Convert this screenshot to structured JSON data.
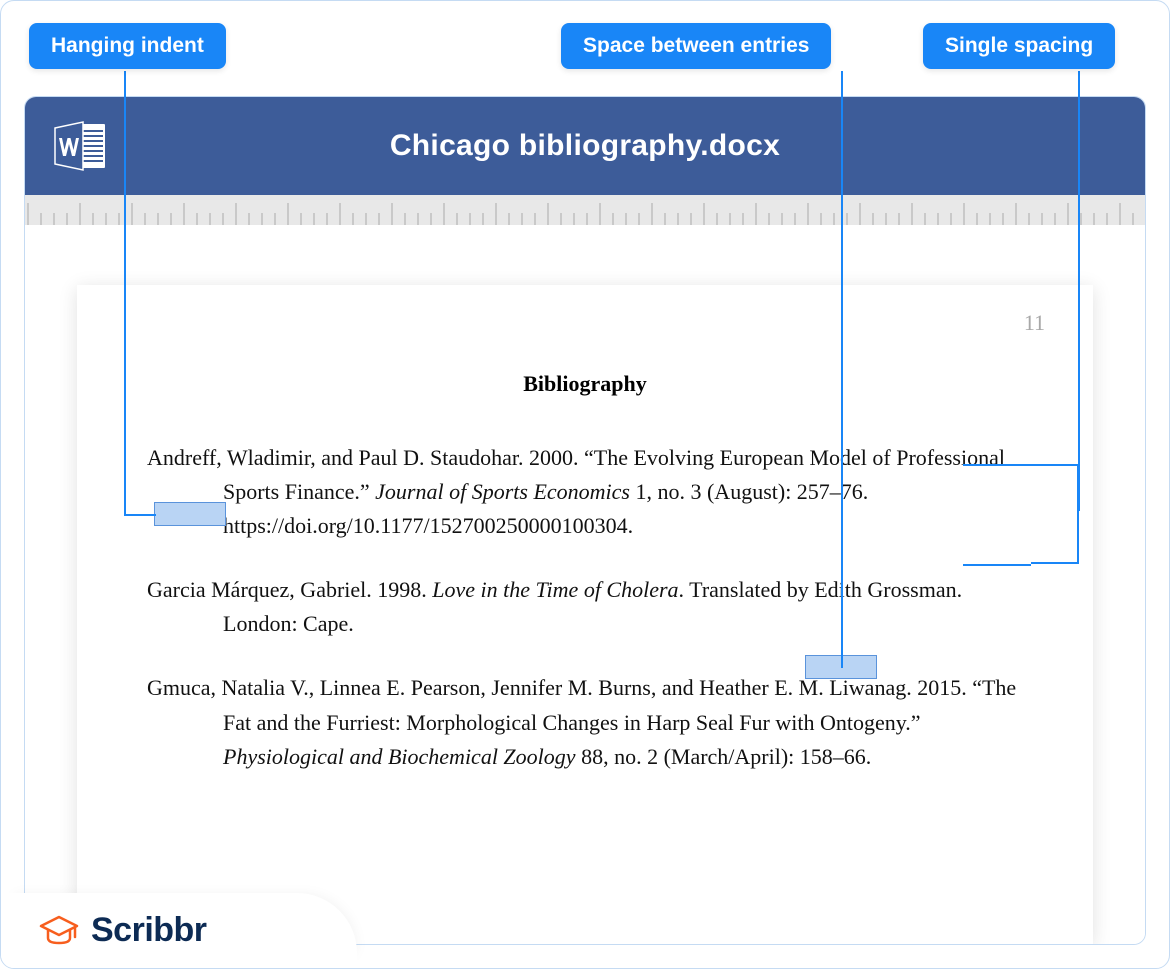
{
  "labels": {
    "hanging": "Hanging indent",
    "space": "Space between entries",
    "spacing": "Single spacing"
  },
  "document": {
    "filename": "Chicago bibliography.docx",
    "page_number": "11",
    "heading": "Bibliography"
  },
  "entries": [
    {
      "prefix": "Andreff, Wladimir, and Paul D. Staudohar. 2000. “The Evolving European Model of Professional Sports Finance.” ",
      "ital": "Journal of Sports Economics",
      "suffix": " 1, no. 3 (August): 257–76. https://doi.org/10.1177/152700250000100304."
    },
    {
      "prefix": "Garcia Márquez, Gabriel. 1998. ",
      "ital": "Love in the Time of Cholera",
      "suffix": ". Translated by Edith Grossman. London: Cape."
    },
    {
      "prefix": "Gmuca, Natalia V., Linnea E. Pearson, Jennifer M. Burns, and Heather E. M. Liwanag. 2015. “The Fat and the Furriest: Morphological Changes in Harp Seal Fur with Ontogeny.” ",
      "ital": "Physiological and Biochemical Zoology",
      "suffix": " 88, no. 2 (March/April): 158–66."
    }
  ],
  "brand": "Scribbr"
}
